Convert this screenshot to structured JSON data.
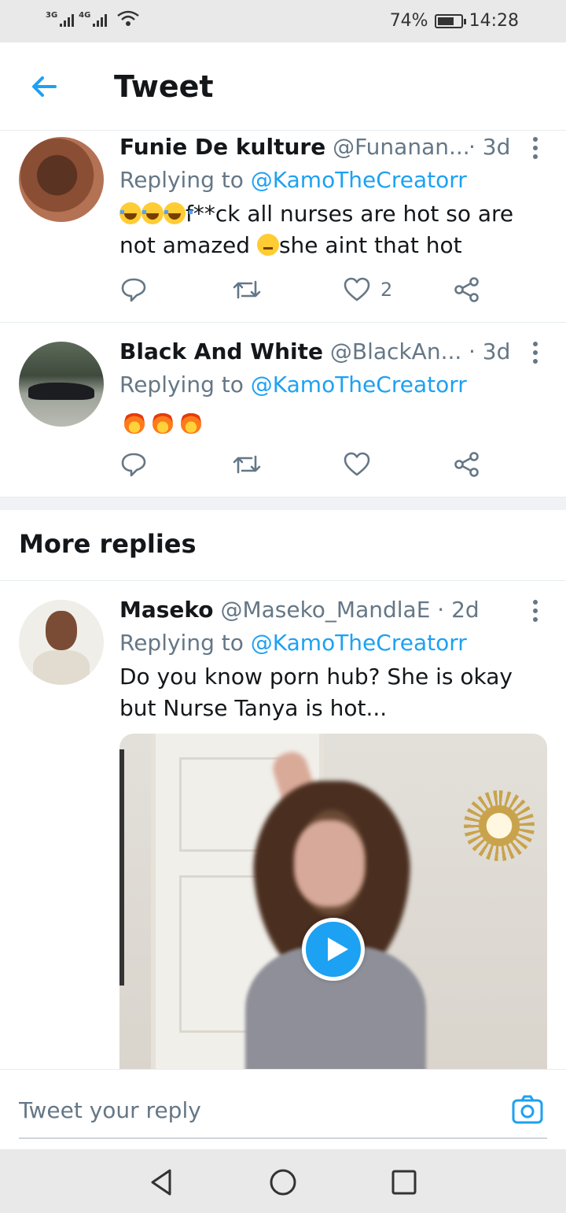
{
  "status_bar": {
    "network1": "3G",
    "network2": "4G",
    "battery_percent": "74%",
    "battery_level": 0.74,
    "time": "14:28"
  },
  "header": {
    "title": "Tweet",
    "back_icon": "arrow-left-icon"
  },
  "tweets": [
    {
      "name": "Funie De kulture",
      "handle": "@Funanan...",
      "time": "· 3d",
      "replying_prefix": "Replying to",
      "replying_to": "@KamoTheCreatorr",
      "body_line1": "f**ck all nurses are hot so are",
      "body_line2_a": "not amazed",
      "body_line2_b": "she aint that hot",
      "likes": "2"
    },
    {
      "name": "Black And White",
      "handle": "@BlackAn...",
      "time": "· 3d",
      "replying_prefix": "Replying to",
      "replying_to": "@KamoTheCreatorr",
      "likes": ""
    }
  ],
  "more_replies": {
    "title": "More replies"
  },
  "reply": {
    "name": "Maseko",
    "handle": "@Maseko_MandlaE",
    "time": "· 2d",
    "replying_prefix": "Replying to",
    "replying_to": "@KamoTheCreatorr",
    "body_line1": "Do you know porn hub? She is okay",
    "body_line2": "but Nurse Tanya is hot..."
  },
  "compose": {
    "placeholder": "Tweet your reply"
  },
  "colors": {
    "accent": "#1da1f2",
    "secondary_text": "#657786",
    "divider": "#e6ecf0"
  }
}
